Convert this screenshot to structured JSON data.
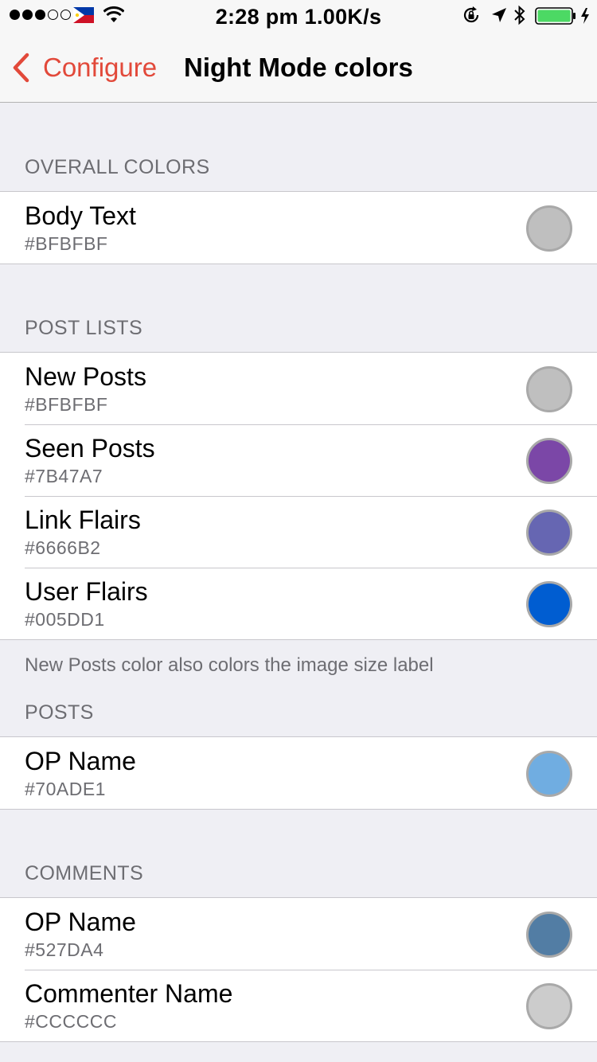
{
  "status": {
    "time_speed": "2:28 pm 1.00K/s"
  },
  "nav": {
    "back_label": "Configure",
    "title": "Night Mode colors"
  },
  "sections": {
    "overall": {
      "header": "OVERALL COLORS",
      "rows": [
        {
          "title": "Body Text",
          "value": "#BFBFBF",
          "color": "#BFBFBF"
        }
      ]
    },
    "post_lists": {
      "header": "POST LISTS",
      "rows": [
        {
          "title": "New Posts",
          "value": "#BFBFBF",
          "color": "#BFBFBF"
        },
        {
          "title": "Seen Posts",
          "value": "#7B47A7",
          "color": "#7B47A7"
        },
        {
          "title": "Link Flairs",
          "value": "#6666B2",
          "color": "#6666B2"
        },
        {
          "title": "User Flairs",
          "value": "#005DD1",
          "color": "#005DD1"
        }
      ],
      "footer": "New Posts color also colors the image size label"
    },
    "posts": {
      "header": "POSTS",
      "rows": [
        {
          "title": "OP Name",
          "value": "#70ADE1",
          "color": "#70ADE1"
        }
      ]
    },
    "comments": {
      "header": "COMMENTS",
      "rows": [
        {
          "title": "OP Name",
          "value": "#527DA4",
          "color": "#527DA4"
        },
        {
          "title": "Commenter Name",
          "value": "#CCCCCC",
          "color": "#CCCCCC"
        }
      ]
    }
  },
  "accent_color": "#E2493A",
  "battery_color": "#4CD964"
}
